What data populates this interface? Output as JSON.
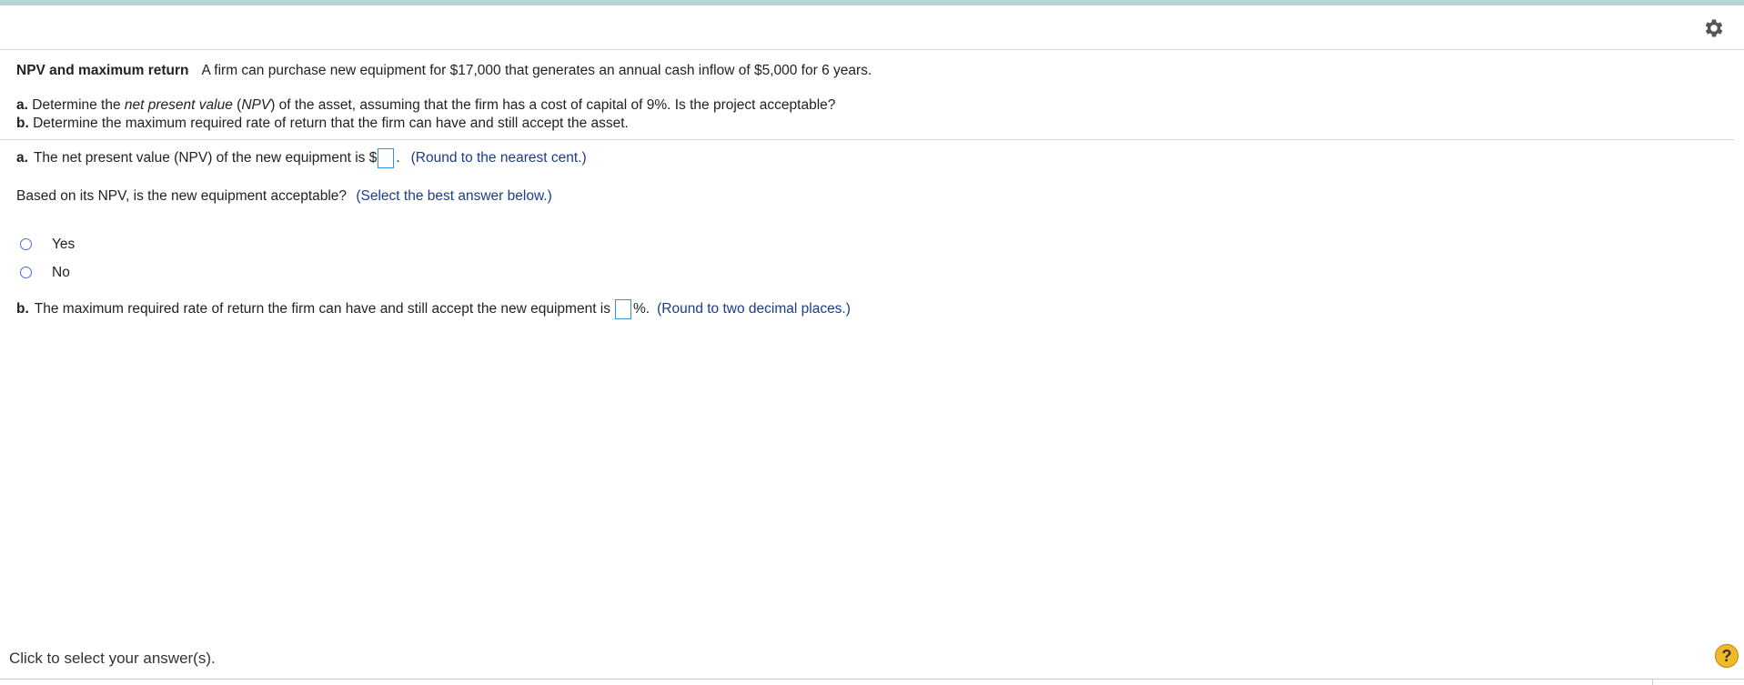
{
  "header": {
    "settings_icon": "gear-icon"
  },
  "problem": {
    "title": "NPV and maximum return",
    "statement": "A firm can purchase new equipment for $17,000 that generates an annual cash inflow of $5,000 for 6 years.",
    "part_a_label": "a.",
    "part_a_text_1": "Determine the ",
    "part_a_italic_1": "net present value",
    "part_a_text_2": " (",
    "part_a_italic_2": "NPV",
    "part_a_text_3": ") of the asset, assuming that the firm has a cost of capital of 9%.  Is the project acceptable?",
    "part_b_label": "b.",
    "part_b_text": "Determine the maximum required rate of return that the firm can have and still accept the asset."
  },
  "answer_a": {
    "label": "a.",
    "text": "The net present value (NPV) of the new equipment is $",
    "after": ".",
    "hint": "(Round to the nearest cent.)"
  },
  "question": {
    "text": "Based on its NPV, is the new equipment acceptable?",
    "hint": "(Select the best answer below.)",
    "options": [
      "Yes",
      "No"
    ]
  },
  "answer_b": {
    "label": "b.",
    "text": "The maximum required rate of return the firm can have and still accept the new equipment is",
    "after": "%.",
    "hint": "(Round to two decimal places.)"
  },
  "footer": {
    "text": "Click to select your answer(s).",
    "help_label": "?"
  },
  "colors": {
    "accent_bar": "#b5d5d0",
    "hint": "#1a3c8b",
    "radio": "#4c6fc9",
    "input_border": "#3b8fd1",
    "help": "#f2b82a"
  }
}
